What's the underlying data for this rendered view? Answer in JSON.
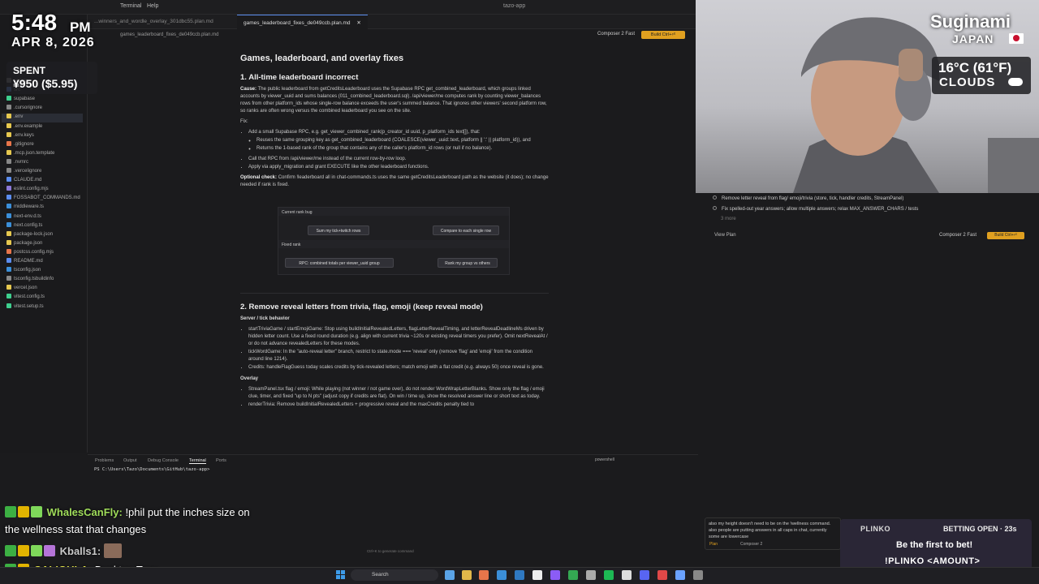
{
  "menu": {
    "items": [
      "Terminal",
      "Help"
    ],
    "app_title": "tazo-app"
  },
  "tabs": [
    {
      "label": "...winners_and_wordle_overlay_301dbc55.plan.md",
      "active": false
    },
    {
      "label": "games_leaderboard_fixes_de049ccb.plan.md",
      "active": true
    }
  ],
  "breadcrumb": "games_leaderboard_fixes_de049ccb.plan.md",
  "composer": {
    "label": "Composer 2 Fast",
    "build": "Build Ctrl+⏎"
  },
  "sidebar": {
    "items": [
      {
        "label": "scripts",
        "color": "#888"
      },
      {
        "label": "src",
        "color": "#5b8def"
      },
      {
        "label": "supabase",
        "color": "#3ecf8e"
      },
      {
        "label": ".cursorignore",
        "color": "#888"
      },
      {
        "label": ".env",
        "color": "#e6c84f",
        "active": true
      },
      {
        "label": ".env.example",
        "color": "#e6c84f"
      },
      {
        "label": ".env.keys",
        "color": "#e6c84f"
      },
      {
        "label": ".gitignore",
        "color": "#e8754a"
      },
      {
        "label": ".mcp.json.template",
        "color": "#e6c84f"
      },
      {
        "label": ".nvmrc",
        "color": "#888"
      },
      {
        "label": ".vercelignore",
        "color": "#888"
      },
      {
        "label": "CLAUDE.md",
        "color": "#5b8def"
      },
      {
        "label": "eslint.config.mjs",
        "color": "#8b79d8"
      },
      {
        "label": "FOSSABOT_COMMANDS.md",
        "color": "#5b8def"
      },
      {
        "label": "middleware.ts",
        "color": "#3b8fd9"
      },
      {
        "label": "next-env.d.ts",
        "color": "#3b8fd9"
      },
      {
        "label": "next.config.ts",
        "color": "#3b8fd9"
      },
      {
        "label": "package-lock.json",
        "color": "#e6c84f"
      },
      {
        "label": "package.json",
        "color": "#e6c84f"
      },
      {
        "label": "postcss.config.mjs",
        "color": "#e8754a"
      },
      {
        "label": "README.md",
        "color": "#5b8def"
      },
      {
        "label": "tsconfig.json",
        "color": "#3b8fd9"
      },
      {
        "label": "tsconfig.tsbuildinfo",
        "color": "#888"
      },
      {
        "label": "vercel.json",
        "color": "#e6c84f"
      },
      {
        "label": "vitest.config.ts",
        "color": "#3ecf8e"
      },
      {
        "label": "vitest.setup.ts",
        "color": "#3ecf8e"
      }
    ]
  },
  "doc": {
    "title": "Games, leaderboard, and overlay fixes",
    "s1": {
      "heading": "1. All-time leaderboard incorrect",
      "cause_label": "Cause:",
      "cause_text": "The public leaderboard from getCreditsLeaderboard uses the Supabase RPC get_combined_leaderboard, which groups linked accounts by viewer_uuid and sums balances (011_combined_leaderboard.sql). /api/viewer/me computes rank by counting viewer_balances rows from other platform_ids whose single-row balance exceeds the user's summed balance. That ignores other viewers' second platform row, so ranks are often wrong versus the combined leaderboard you see on the site.",
      "fix_label": "Fix:",
      "fix_1": "Add a small Supabase RPC, e.g. get_viewer_combined_rank(p_creator_id uuid, p_platform_ids text[]), that:",
      "fix_1a": "Reuses the same grouping key as get_combined_leaderboard (COALESCE(viewer_uuid::text, platform || ':' || platform_id)), and",
      "fix_1b": "Returns the 1-based rank of the group that contains any of the caller's platform_id rows (or null if no balance).",
      "fix_2": "Call that RPC from /api/viewer/me instead of the current row-by-row loop.",
      "fix_3": "Apply via apply_migration and grant EXECUTE like the other leaderboard functions.",
      "optional_label": "Optional check:",
      "optional_text": "Confirm !leaderboard all in chat-commands.ts uses the same getCreditsLeaderboard path as the website (it does); no change needed if rank is fixed."
    },
    "diagram": {
      "band1": "Current rank bug",
      "box1": "Sum my tick+twitch rows",
      "box2": "Compare to each single row",
      "band2": "Fixed rank",
      "box3": "RPC: combined totals per viewer_uuid group",
      "box4": "Rank my group vs others"
    },
    "s2": {
      "heading": "2. Remove reveal letters from trivia, flag, emoji (keep reveal mode)",
      "sub1": "Server / tick behavior",
      "b1": "startTriviaGame / startEmojiGame: Stop using buildInitialRevealedLetters, flagLetterRevealTiming, and letterRevealDeadlineMs driven by hidden letter count. Use a fixed round duration (e.g. align with current trivia ~120s or existing reveal timers you prefer). Omit nextRevealAt / or do not advance revealedLetters for these modes.",
      "b2": "tickWordGame: In the \"auto-reveal letter\" branch, restrict to state.mode === 'reveal' only (remove 'flag' and 'emoji' from the condition around line 1214).",
      "b3": "Credits: handleFlagGuess today scales credits by tick-revealed letters; match emoji with a flat credit (e.g. always 50) once reveal is gone.",
      "sub2": "Overlay",
      "b4": "StreamPanel.tsx flag / emoji: While playing (not winner / not game over), do not render WordWrapLetterBlanks. Show only the flag / emoji clue, timer, and fixed \"up to N pts\" (adjust copy if credits are flat). On win / time up, show the resolved answer line or short text as today.",
      "b5": "renderTrivia: Remove buildInitialRevealedLetters + progressive reveal and the maxCredits penalty tied to"
    }
  },
  "panel": {
    "tabs": [
      "Problems",
      "Output",
      "Debug Console",
      "Terminal",
      "Ports"
    ],
    "active": "Terminal",
    "shell": "powershell",
    "prompt": "PS C:\\Users\\Tazo\\Documents\\GitHub\\tazo-app>"
  },
  "right": {
    "todos": [
      "Remove letter reveal from flag/ emoji/trivia (store, tick, handler credits, StreamPanel)",
      "Fix spelled-out year answers; allow multiple answers; relax MAX_ANSWER_CHARS / tests"
    ],
    "more": "3 more",
    "view_plan": "View Plan",
    "composer": "Composer 2 Fast",
    "build": "Build Ctrl+⏎"
  },
  "ai_input": {
    "text": "also my height doesn't need to be on the !wellness command. also people are putting answers in all caps in chat, currently some are lowercase",
    "mode": "Plan",
    "composer": "Composer 2",
    "hint": "Ctrl+K to generate command"
  },
  "overlay": {
    "time": "5:48",
    "ampm": "PM",
    "date": "APR 8, 2026",
    "spent_label": "SPENT",
    "spent_value": "¥950 ($5.95)",
    "city": "Suginami",
    "country": "JAPAN",
    "temp": "16°C (61°F)",
    "condition": "CLOUDS"
  },
  "chat": [
    {
      "user": "WhalesCanFly:",
      "msg": "!phil put the inches size on",
      "msg2": "the wellness stat that changes"
    },
    {
      "user": "Kballs1:",
      "msg": ""
    },
    {
      "user": "CALIGULA:",
      "msg": "Desktop Tazo"
    }
  ],
  "plinko": {
    "title": "PLINKO",
    "status": "BETTING OPEN · 23s",
    "cta": "Be the first to bet!",
    "cmd": "!PLINKO <AMOUNT>"
  },
  "taskbar": {
    "search": "Search"
  }
}
